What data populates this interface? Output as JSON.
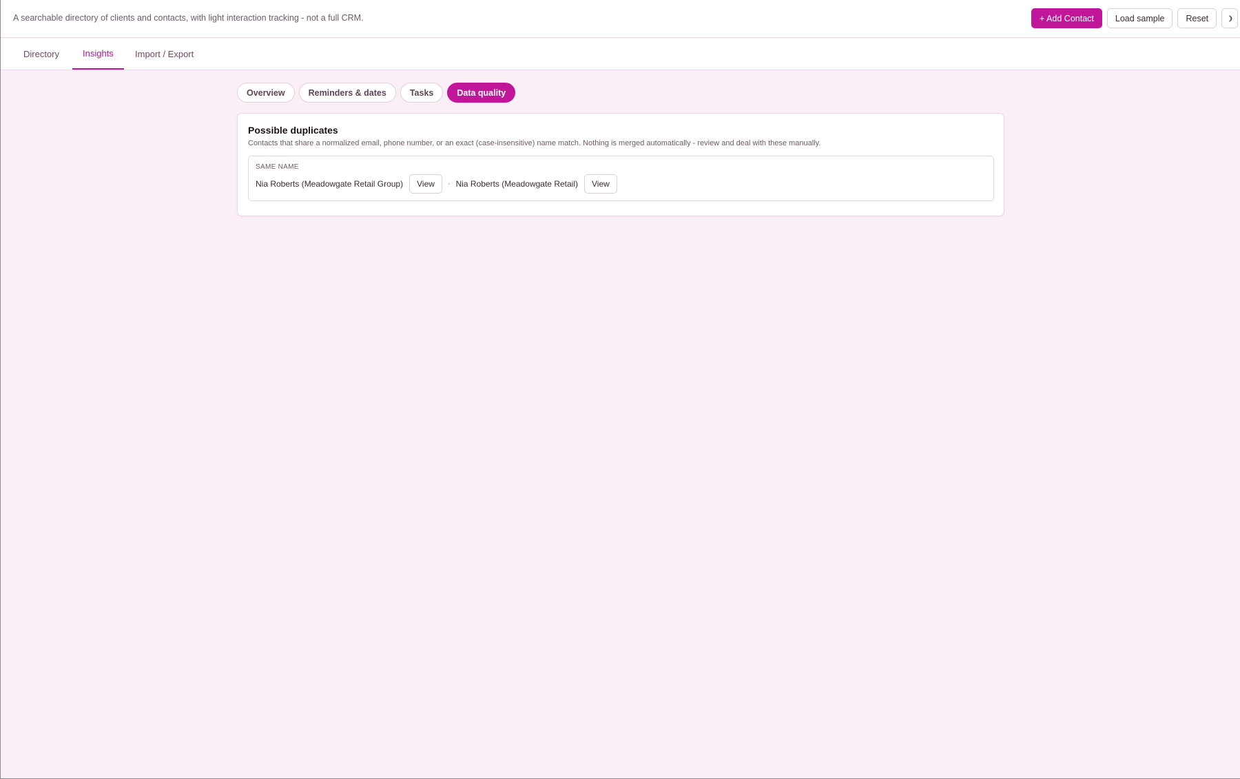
{
  "header": {
    "tagline": "A searchable directory of clients and contacts, with light interaction tracking - not a full CRM.",
    "actions": {
      "add_contact": "+ Add Contact",
      "load_sample": "Load sample",
      "reset": "Reset"
    },
    "theme_toggle_icon": "moon-icon"
  },
  "nav": {
    "tabs": [
      {
        "label": "Directory",
        "active": false
      },
      {
        "label": "Insights",
        "active": true
      },
      {
        "label": "Import / Export",
        "active": false
      }
    ]
  },
  "insights": {
    "subtabs": [
      {
        "label": "Overview",
        "active": false
      },
      {
        "label": "Reminders & dates",
        "active": false
      },
      {
        "label": "Tasks",
        "active": false
      },
      {
        "label": "Data quality",
        "active": true
      }
    ]
  },
  "duplicates": {
    "title": "Possible duplicates",
    "description": "Contacts that share a normalized email, phone number, or an exact (case-insensitive) name match. Nothing is merged automatically - review and deal with these manually.",
    "groups": [
      {
        "label": "Same name",
        "separator": "·",
        "contacts": [
          {
            "name": "Nia Roberts (Meadowgate Retail Group)",
            "view_label": "View"
          },
          {
            "name": "Nia Roberts (Meadowgate Retail)",
            "view_label": "View"
          }
        ]
      }
    ]
  },
  "colors": {
    "accent": "#c2169a",
    "page_background": "#fbeff7"
  }
}
